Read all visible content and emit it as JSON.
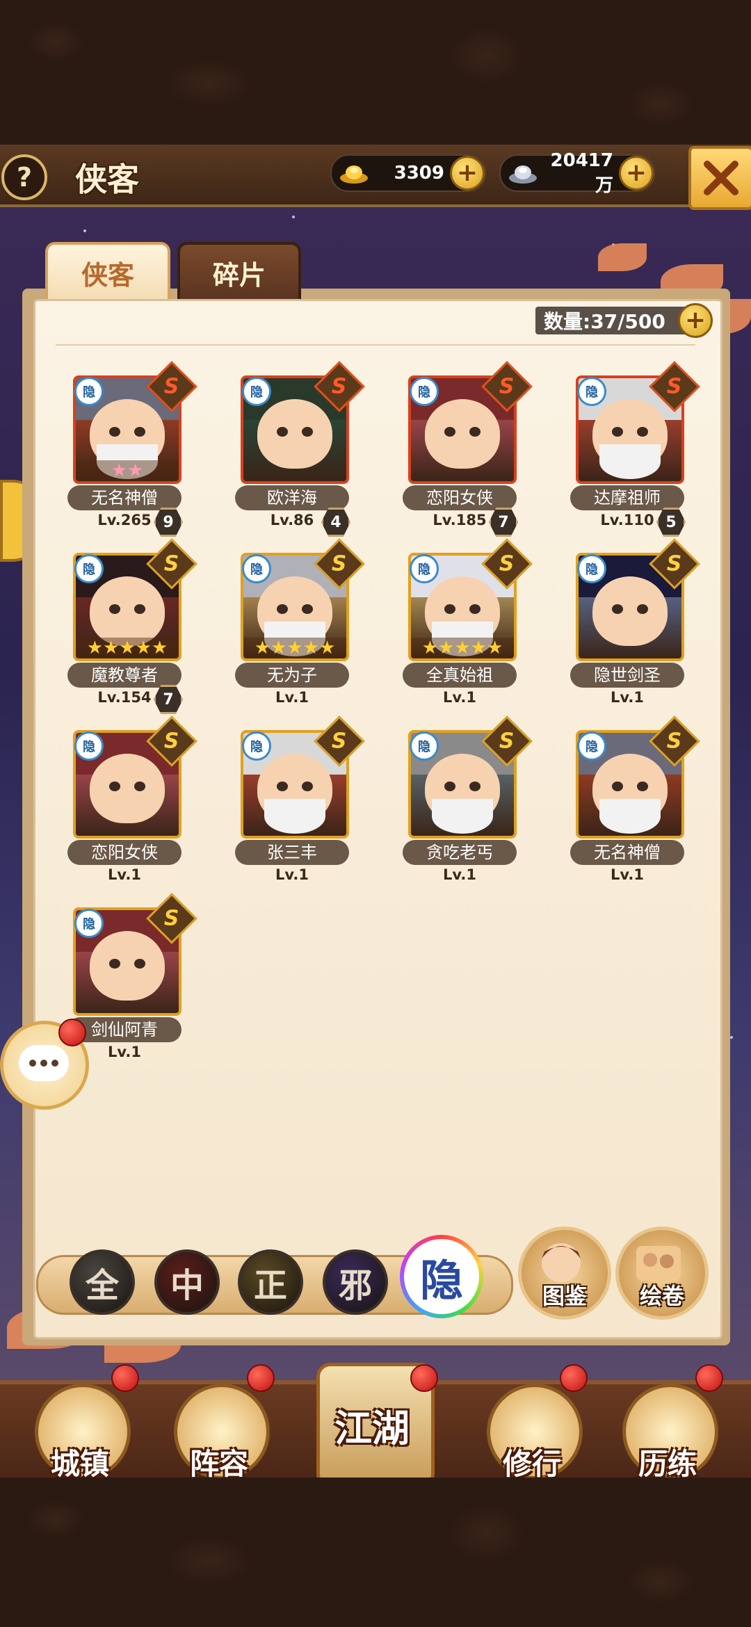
{
  "header": {
    "title": "侠客",
    "help_label": "?",
    "gold_value": "3309",
    "silver_value": "20417万"
  },
  "tabs": [
    {
      "label": "侠客",
      "active": true
    },
    {
      "label": "碎片",
      "active": false
    }
  ],
  "roster": {
    "count_label": "数量:37/500"
  },
  "heroes": [
    {
      "name": "无名神僧",
      "level": "Lv.265",
      "rank": "9",
      "rarity": "S",
      "tier": "red",
      "stars": 2,
      "star_color": "pink",
      "tag": "隐",
      "icon": "monk-portrait"
    },
    {
      "name": "欧洋海",
      "level": "Lv.86",
      "rank": "4",
      "rarity": "S",
      "tier": "red",
      "stars": 0,
      "tag": "隐",
      "icon": "warrior-portrait"
    },
    {
      "name": "恋阳女侠",
      "level": "Lv.185",
      "rank": "7",
      "rarity": "S",
      "tier": "red",
      "stars": 0,
      "tag": "隐",
      "icon": "heroine-portrait"
    },
    {
      "name": "达摩祖师",
      "level": "Lv.110",
      "rank": "5",
      "rarity": "S",
      "tier": "red",
      "stars": 0,
      "tag": "隐",
      "icon": "elder-portrait"
    },
    {
      "name": "魔教尊者",
      "level": "Lv.154",
      "rank": "7",
      "rarity": "S",
      "tier": "gold",
      "stars": 5,
      "tag": "隐",
      "icon": "demon-lord-portrait"
    },
    {
      "name": "无为子",
      "level": "Lv.1",
      "rank": "",
      "rarity": "S",
      "tier": "gold",
      "stars": 5,
      "tag": "隐",
      "icon": "sage-portrait"
    },
    {
      "name": "全真始祖",
      "level": "Lv.1",
      "rank": "",
      "rarity": "S",
      "tier": "gold",
      "stars": 5,
      "tag": "隐",
      "icon": "taoist-portrait"
    },
    {
      "name": "隐世剑圣",
      "level": "Lv.1",
      "rank": "",
      "rarity": "S",
      "tier": "gold",
      "stars": 0,
      "tag": "隐",
      "icon": "swordsman-portrait"
    },
    {
      "name": "恋阳女侠",
      "level": "Lv.1",
      "rank": "",
      "rarity": "S",
      "tier": "gold",
      "stars": 0,
      "tag": "隐",
      "icon": "heroine-portrait"
    },
    {
      "name": "张三丰",
      "level": "Lv.1",
      "rank": "",
      "rarity": "S",
      "tier": "gold",
      "stars": 0,
      "tag": "隐",
      "icon": "elder-portrait"
    },
    {
      "name": "贪吃老丐",
      "level": "Lv.1",
      "rank": "",
      "rarity": "S",
      "tier": "gold",
      "stars": 0,
      "tag": "隐",
      "icon": "beggar-portrait"
    },
    {
      "name": "无名神僧",
      "level": "Lv.1",
      "rank": "",
      "rarity": "S",
      "tier": "gold",
      "stars": 0,
      "tag": "隐",
      "icon": "monk-portrait"
    },
    {
      "name": "剑仙阿青",
      "level": "Lv.1",
      "rank": "",
      "rarity": "S",
      "tier": "gold",
      "stars": 0,
      "tag": "隐",
      "icon": "heroine-portrait"
    }
  ],
  "filters": [
    {
      "label": "全",
      "color": "#4a4640"
    },
    {
      "label": "中",
      "color": "#5a1e1a"
    },
    {
      "label": "正",
      "color": "#5a4a22"
    },
    {
      "label": "邪",
      "color": "#3a2a5a"
    },
    {
      "label": "隐",
      "color": "#ffffff",
      "active": true
    }
  ],
  "side_buttons": [
    {
      "label": "图鉴"
    },
    {
      "label": "绘卷"
    }
  ],
  "nav": [
    {
      "label": "城镇"
    },
    {
      "label": "阵容"
    },
    {
      "label": "江湖"
    },
    {
      "label": "修行"
    },
    {
      "label": "历练"
    }
  ],
  "colors": {
    "accent_gold": "#e0a020",
    "tier_red": "#d8401e",
    "panel_bg": "#fbf3e4"
  }
}
